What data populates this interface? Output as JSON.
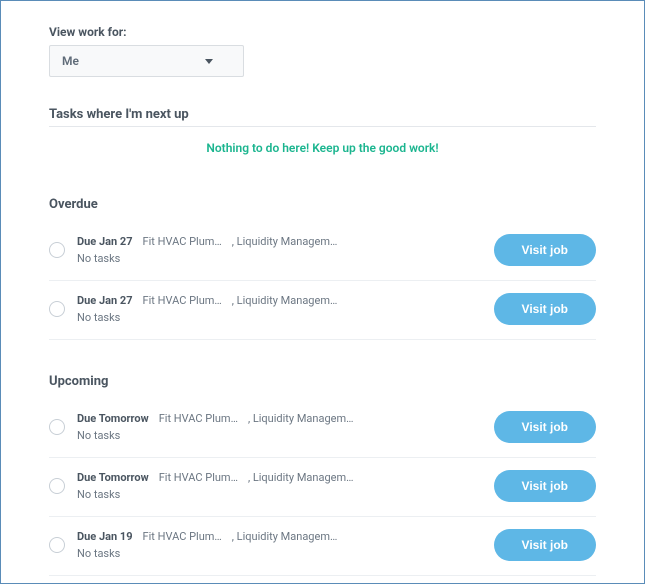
{
  "filter": {
    "label": "View work for:",
    "selected": "Me"
  },
  "nextUp": {
    "title": "Tasks where I'm next up",
    "emptyMessage": "Nothing to do here! Keep up the good work!"
  },
  "overdue": {
    "title": "Overdue",
    "items": [
      {
        "due": "Due Jan 27",
        "job": "Fit HVAC Plum…",
        "client": ", Liquidity Managem…",
        "tasks": "No tasks",
        "button": "Visit job"
      },
      {
        "due": "Due Jan 27",
        "job": "Fit HVAC Plum…",
        "client": ", Liquidity Managem…",
        "tasks": "No tasks",
        "button": "Visit job"
      }
    ]
  },
  "upcoming": {
    "title": "Upcoming",
    "items": [
      {
        "due": "Due Tomorrow",
        "job": "Fit HVAC Plum…",
        "client": ", Liquidity Managem…",
        "tasks": "No tasks",
        "button": "Visit job"
      },
      {
        "due": "Due Tomorrow",
        "job": "Fit HVAC Plum…",
        "client": ", Liquidity Managem…",
        "tasks": "No tasks",
        "button": "Visit job"
      },
      {
        "due": "Due Jan 19",
        "job": "Fit HVAC Plum…",
        "client": ", Liquidity Managem…",
        "tasks": "No tasks",
        "button": "Visit job"
      }
    ]
  }
}
